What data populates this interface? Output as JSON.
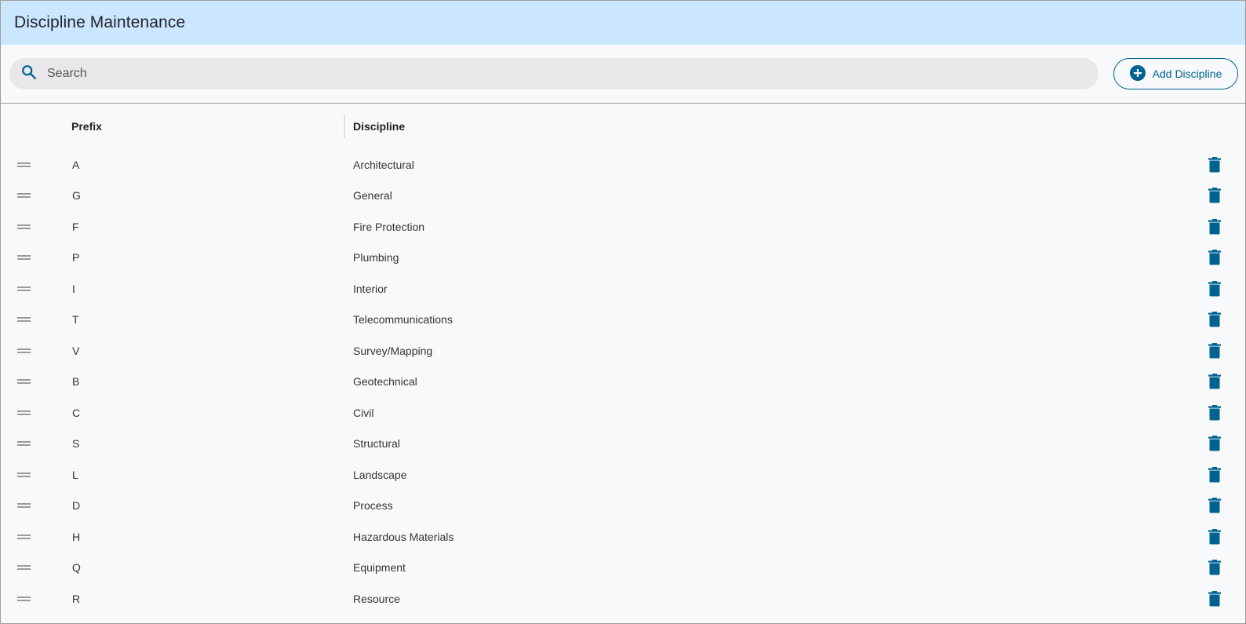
{
  "header": {
    "title": "Discipline Maintenance"
  },
  "toolbar": {
    "search_placeholder": "Search",
    "search_value": "",
    "add_label": "Add Discipline"
  },
  "table": {
    "columns": {
      "prefix": "Prefix",
      "discipline": "Discipline"
    },
    "rows": [
      {
        "prefix": "A",
        "discipline": "Architectural"
      },
      {
        "prefix": "G",
        "discipline": "General"
      },
      {
        "prefix": "F",
        "discipline": "Fire Protection"
      },
      {
        "prefix": "P",
        "discipline": "Plumbing"
      },
      {
        "prefix": "I",
        "discipline": "Interior"
      },
      {
        "prefix": "T",
        "discipline": "Telecommunications"
      },
      {
        "prefix": "V",
        "discipline": "Survey/Mapping"
      },
      {
        "prefix": "B",
        "discipline": "Geotechnical"
      },
      {
        "prefix": "C",
        "discipline": "Civil"
      },
      {
        "prefix": "S",
        "discipline": "Structural"
      },
      {
        "prefix": "L",
        "discipline": "Landscape"
      },
      {
        "prefix": "D",
        "discipline": "Process"
      },
      {
        "prefix": "H",
        "discipline": "Hazardous Materials"
      },
      {
        "prefix": "Q",
        "discipline": "Equipment"
      },
      {
        "prefix": "R",
        "discipline": "Resource"
      }
    ]
  },
  "icons": {
    "search": "search-icon",
    "add": "add-circle-icon",
    "drag": "drag-handle-icon",
    "delete": "trash-icon"
  },
  "colors": {
    "header_bg": "#cbe6ff",
    "accent": "#00628f",
    "search_bg": "#e8e8ea",
    "page_bg": "#f8f9fb"
  }
}
